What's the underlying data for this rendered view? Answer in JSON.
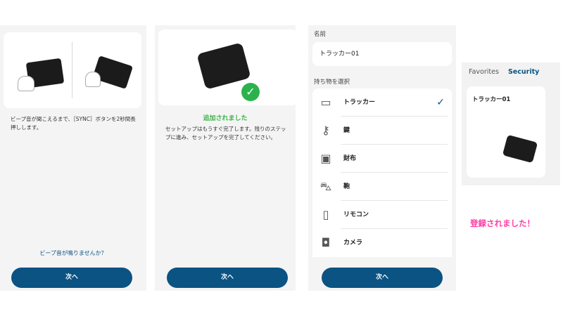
{
  "step1": {
    "instruction": "ビープ音が聞こえるまで、［SYNC］ボタンを2秒間長押しします。",
    "help_link": "ビープ音が鳴りませんか？",
    "next_label": "次へ"
  },
  "step2": {
    "success_title": "追加されました",
    "description": "セットアップはもうすぐ完了します。残りのステップに進み、セットアップを完了してください。",
    "next_label": "次へ"
  },
  "step3": {
    "name_label": "名前",
    "name_value": "トラッカー01",
    "select_label": "持ち物を選択",
    "items": [
      {
        "label": "トラッカー",
        "icon": "tracker-icon",
        "selected": true
      },
      {
        "label": "鍵",
        "icon": "key-icon",
        "selected": false
      },
      {
        "label": "財布",
        "icon": "wallet-icon",
        "selected": false
      },
      {
        "label": "鞄",
        "icon": "bag-icon",
        "selected": false
      },
      {
        "label": "リモコン",
        "icon": "remote-icon",
        "selected": false
      },
      {
        "label": "カメラ",
        "icon": "camera-icon",
        "selected": false
      }
    ],
    "next_label": "次へ"
  },
  "step4": {
    "tabs": [
      "Favorites",
      "Security"
    ],
    "active_tab": "Security",
    "device_name": "トラッカー01"
  },
  "caption": "登録されました！",
  "colors": {
    "primary": "#0b5383",
    "success": "#2bb24c",
    "caption": "#ff3ea5"
  }
}
